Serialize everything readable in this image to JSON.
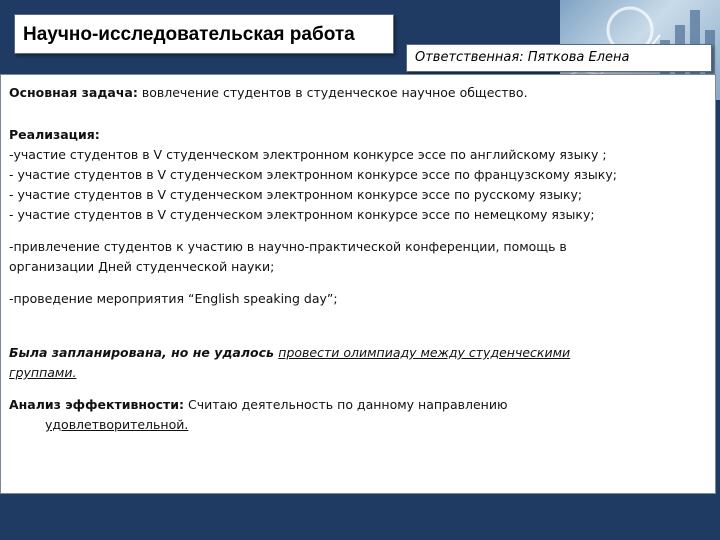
{
  "header": {
    "title": "Научно-исследовательская работа",
    "responsible": "Ответственная: Пяткова Елена"
  },
  "content": {
    "main_task_label": "Основная задача:",
    "main_task_text": " вовлечение студентов в студенческое научное общество.",
    "implementation_label": "Реализация:",
    "essay_items": [
      "-участие студентов в V студенческом электронном конкурсе эссе по английскому языку ;",
      "- участие студентов в V студенческом электронном конкурсе эссе по французскому языку;",
      "- участие студентов в V студенческом электронном конкурсе эссе по русскому языку;",
      "- участие студентов в V студенческом электронном конкурсе эссе по немецкому языку;"
    ],
    "conference_line1": "-привлечение студентов к участию в научно-практической конференции, помощь в",
    "conference_line2": "организации Дней студенческой науки;",
    "event_text": "-проведение мероприятия “English speaking day”;",
    "planned_prefix": "Была запланирована, но не удалось ",
    "planned_underlined_1": "провести олимпиаду между студенческими",
    "planned_underlined_2": "группами.",
    "analysis_label": "Анализ эффективности:",
    "analysis_text": "  Считаю деятельность по данному направлению",
    "analysis_result": "удовлетворительной."
  }
}
